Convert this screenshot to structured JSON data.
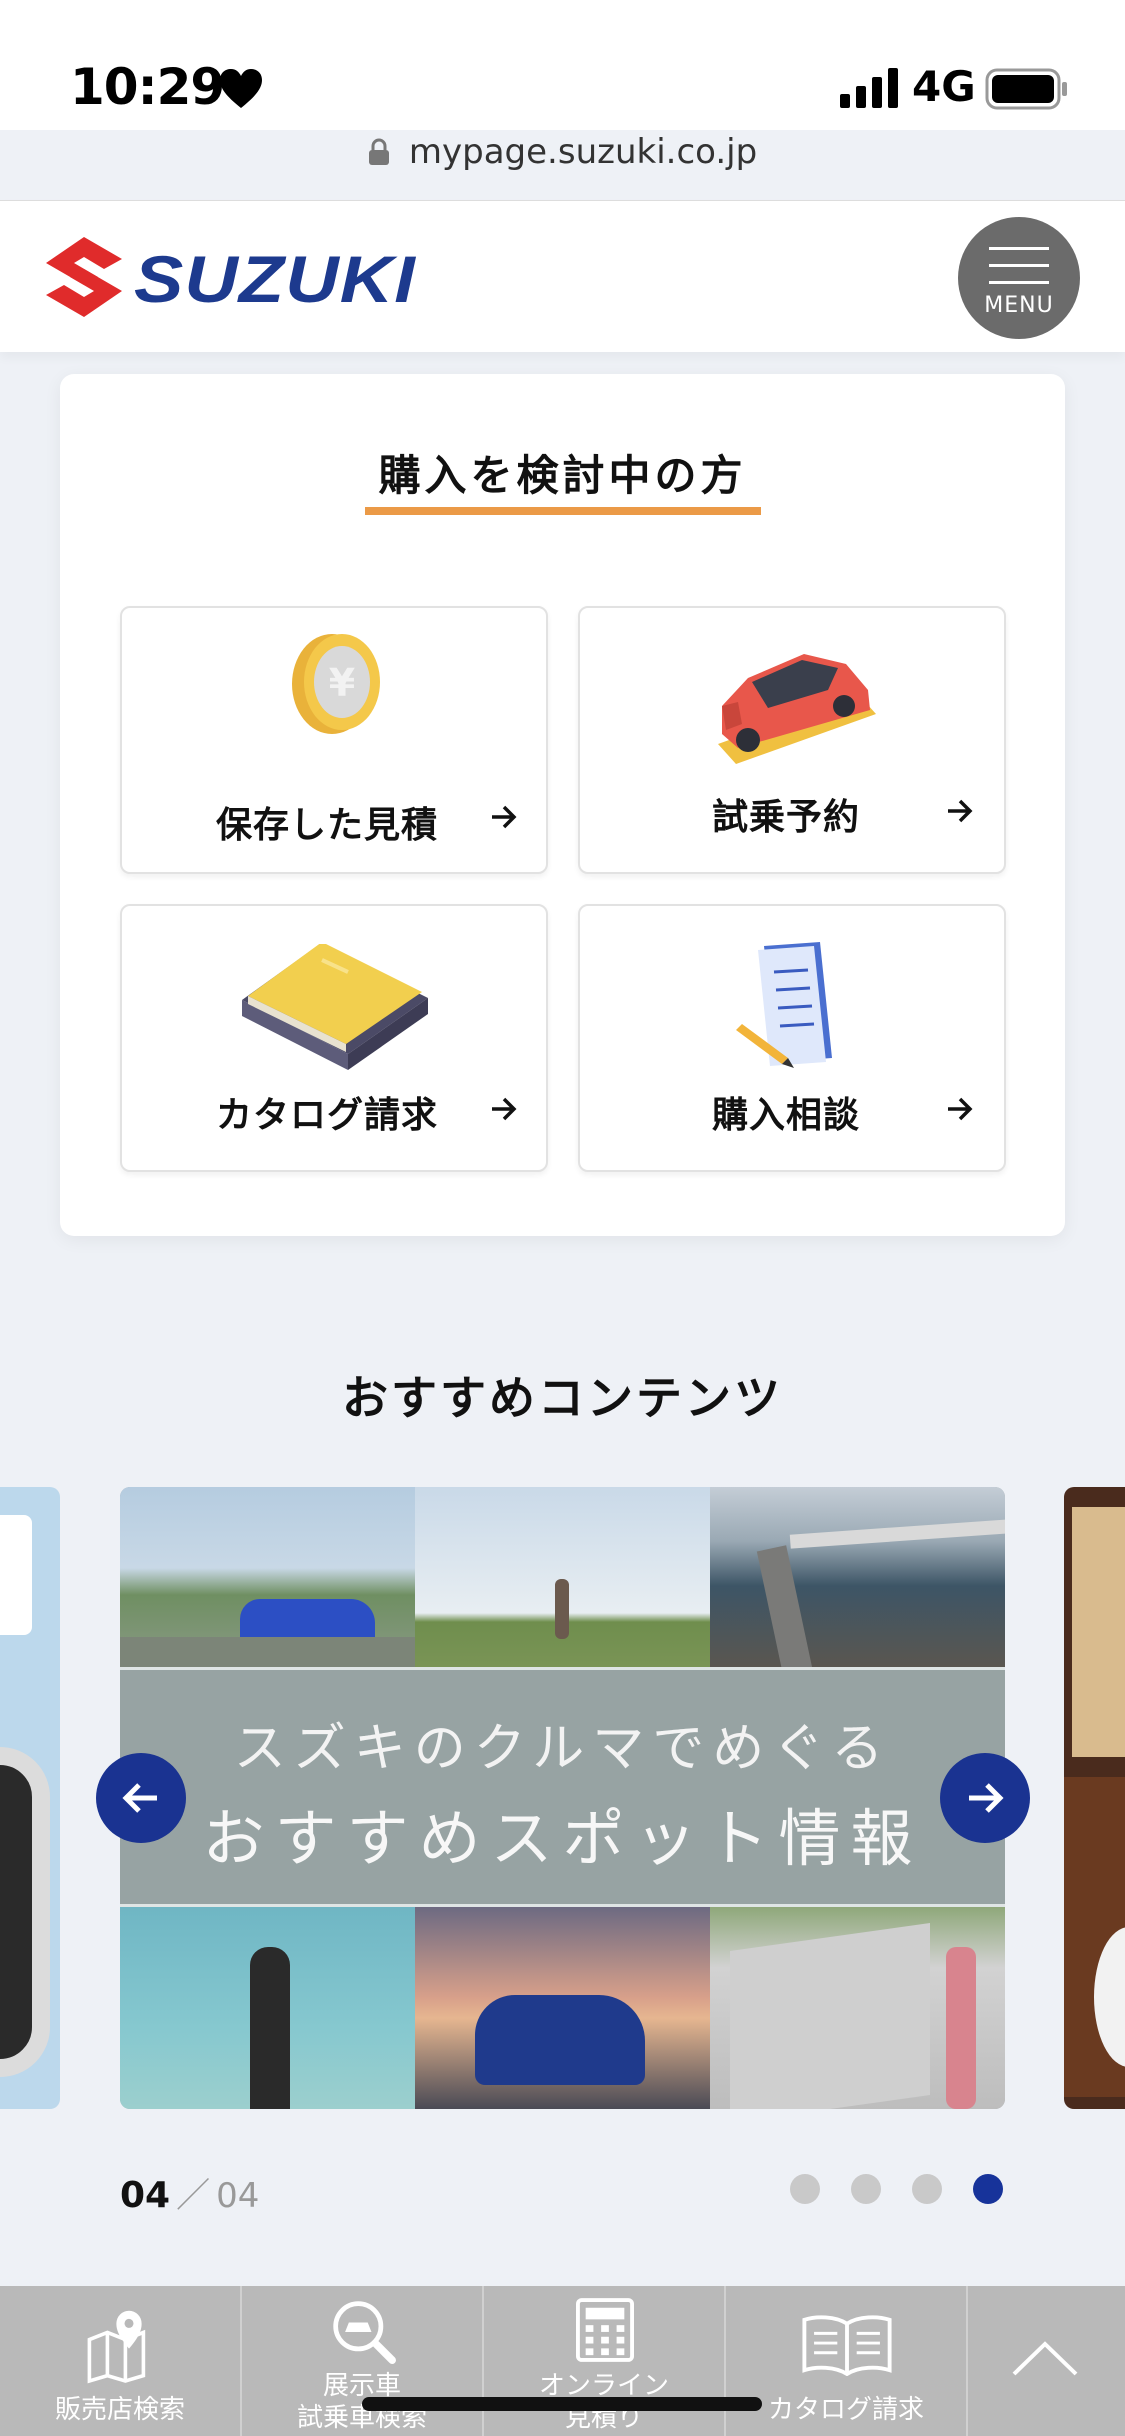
{
  "status_bar": {
    "time": "10:29",
    "network": "4G",
    "heart_icon": "heart-icon",
    "signal_icon": "signal-icon",
    "battery_icon": "battery-icon"
  },
  "browser": {
    "url": "mypage.suzuki.co.jp",
    "lock_icon": "lock-icon"
  },
  "header": {
    "logo_text": "SUZUKI",
    "menu_label": "MENU",
    "brand_color": "#1d3a8e",
    "logo_red": "#e02b2b"
  },
  "consider": {
    "title": "購入を検討中の方",
    "underline_color": "#eb9a47",
    "tiles": [
      {
        "label": "保存した見積",
        "icon": "yen-coin-icon"
      },
      {
        "label": "試乗予約",
        "icon": "car-icon"
      },
      {
        "label": "カタログ請求",
        "icon": "book-icon"
      },
      {
        "label": "購入相談",
        "icon": "clipboard-pencil-icon"
      }
    ]
  },
  "recommended": {
    "title": "おすすめコンテンツ",
    "banner_line1": "スズキのクルマでめぐる",
    "banner_line2": "おすすめスポット情報",
    "current_page": "04",
    "separator": "／",
    "total_pages": "04",
    "dots_count": 4,
    "active_dot": 4,
    "accent_color": "#17339a"
  },
  "bottom_nav": {
    "items": [
      {
        "label_line1": "販売店検索",
        "label_line2": "",
        "icon": "map-pin-icon"
      },
      {
        "label_line1": "展示車",
        "label_line2": "試乗車検索",
        "icon": "car-search-icon"
      },
      {
        "label_line1": "オンライン",
        "label_line2": "見積り",
        "icon": "calculator-icon"
      },
      {
        "label_line1": "カタログ請求",
        "label_line2": "",
        "icon": "open-book-icon"
      }
    ],
    "scroll_top_icon": "chevron-up-icon"
  }
}
